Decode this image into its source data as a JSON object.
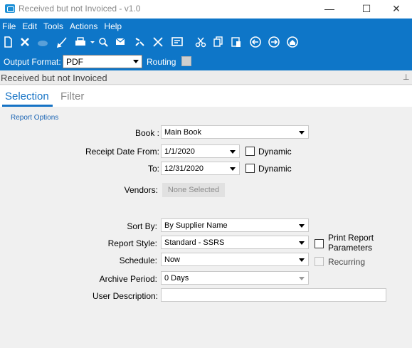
{
  "window": {
    "title": "Received but not Invoiced - v1.0"
  },
  "menu": {
    "items": [
      "File",
      "Edit",
      "Tools",
      "Actions",
      "Help"
    ]
  },
  "toolbar": {
    "icons": [
      "new-icon",
      "delete-icon",
      "blank-icon",
      "clear-icon",
      "print-icon",
      "preview-icon",
      "email-icon",
      "fax-icon",
      "export-icon",
      "archive-icon",
      "cut-icon",
      "copy-icon",
      "paste-icon",
      "back-icon",
      "forward-icon",
      "home-icon"
    ]
  },
  "output": {
    "label": "Output Format:",
    "value": "PDF",
    "routing_label": "Routing"
  },
  "panel": {
    "title": "Received but not Invoiced",
    "pin_glyph": "⊥"
  },
  "tabs": {
    "selection": "Selection",
    "filter": "Filter"
  },
  "form": {
    "section_title": "Report Options",
    "book_label": "Book :",
    "book_value": "Main Book",
    "receipt_from_label": "Receipt Date From:",
    "receipt_from_value": "1/1/2020",
    "dynamic_label": "Dynamic",
    "to_label": "To:",
    "to_value": "12/31/2020",
    "vendors_label": "Vendors:",
    "vendors_button": "None Selected",
    "sort_by_label": "Sort By:",
    "sort_by_value": "By Supplier Name",
    "report_style_label": "Report Style:",
    "report_style_value": "Standard - SSRS",
    "print_params_label_1": "Print Report",
    "print_params_label_2": "Parameters",
    "schedule_label": "Schedule:",
    "schedule_value": "Now",
    "recurring_label": "Recurring",
    "archive_label": "Archive Period:",
    "archive_value": "0 Days",
    "user_desc_label": "User Description:",
    "user_desc_value": ""
  },
  "colors": {
    "accent": "#0e76c8",
    "tab_active": "#1673c5",
    "link": "#1a64b4"
  }
}
